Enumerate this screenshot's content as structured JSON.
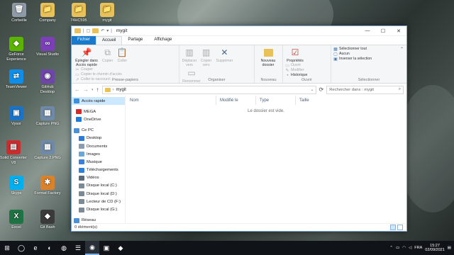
{
  "desktop": {
    "icons": [
      {
        "label": "Corbeille",
        "color": "#8e9aa8",
        "glyph": "🗑"
      },
      {
        "label": "Company",
        "color": "#e8c158",
        "glyph": "📁"
      },
      {
        "label": "74HC595",
        "color": "#e8c158",
        "glyph": "📁"
      },
      {
        "label": "mygit",
        "color": "#e8c158",
        "glyph": "📁"
      },
      {
        "label": "GeForce Experience",
        "color": "#5bb500",
        "glyph": "◆"
      },
      {
        "label": "Visual Studio",
        "color": "#7b3fb8",
        "glyph": "∞"
      },
      {
        "label": "TeamViewer",
        "color": "#0e8ee9",
        "glyph": "⇄"
      },
      {
        "label": "GitHub Desktop",
        "color": "#6e45a8",
        "glyph": "◉"
      },
      {
        "label": "Vysor",
        "color": "#1a73c9",
        "glyph": "▣"
      },
      {
        "label": "Capture PNG",
        "color": "#6f8aa7",
        "glyph": "▦"
      },
      {
        "label": "Solid Converter V8",
        "color": "#c92d2d",
        "glyph": "▤"
      },
      {
        "label": "Capture 2.PNG",
        "color": "#6f8aa7",
        "glyph": "▦"
      },
      {
        "label": "Skype",
        "color": "#00aff0",
        "glyph": "S"
      },
      {
        "label": "Format Factory",
        "color": "#d9822b",
        "glyph": "✱"
      },
      {
        "label": "Excel",
        "color": "#1f7244",
        "glyph": "X"
      },
      {
        "label": "Git Bash",
        "color": "#3a3a3a",
        "glyph": "◆"
      }
    ]
  },
  "window": {
    "title": "mygit",
    "controls": {
      "minimize": "—",
      "maximize": "☐",
      "close": "✕"
    },
    "tabs": [
      "Fichier",
      "Accueil",
      "Partage",
      "Affichage"
    ],
    "ribbon": {
      "presse_papiers": {
        "label": "Presse-papiers",
        "pin": "Épingler dans Accès rapide",
        "copy": "Copier",
        "paste": "Coller",
        "cut": "Couper",
        "copy_path": "Copier le chemin d'accès",
        "paste_shortcut": "Coller le raccourci"
      },
      "organiser": {
        "label": "Organiser",
        "move": "Déplacer vers",
        "copy_to": "Copier vers",
        "delete": "Supprimer",
        "rename": "Renommer"
      },
      "nouveau": {
        "label": "Nouveau",
        "new_folder": "Nouveau dossier"
      },
      "ouvrir": {
        "label": "Ouvrir",
        "properties": "Propriétés",
        "open": "Ouvrir",
        "modify": "Modifier",
        "history": "Historique"
      },
      "selectionner": {
        "label": "Sélectionner",
        "select_all": "Sélectionner tout",
        "select_none": "Aucun",
        "invert": "Inverser la sélection"
      }
    },
    "address": {
      "path": "mygit",
      "search_placeholder": "Rechercher dans : mygit"
    },
    "nav": [
      {
        "label": "Accès rapide",
        "color": "#3d8fe0",
        "selected": true
      },
      {
        "label": "MEGA",
        "color": "#d9272e"
      },
      {
        "label": "OneDrive",
        "color": "#1b7de0"
      },
      {
        "label": "Ce PC",
        "color": "#4a90d9"
      },
      {
        "label": "Desktop",
        "color": "#2e7bd6"
      },
      {
        "label": "Documents",
        "color": "#8a9bb0"
      },
      {
        "label": "Images",
        "color": "#6aa6d6"
      },
      {
        "label": "Musique",
        "color": "#3d7fd6"
      },
      {
        "label": "Téléchargements",
        "color": "#2f80d8"
      },
      {
        "label": "Vidéos",
        "color": "#5a6a7a"
      },
      {
        "label": "Disque local (C:)",
        "color": "#7c8a96"
      },
      {
        "label": "Disque local (D:)",
        "color": "#7c8a96"
      },
      {
        "label": "Lecteur de CD (F:)",
        "color": "#7c8a96"
      },
      {
        "label": "Disque local (G:)",
        "color": "#7c8a96"
      },
      {
        "label": "Réseau",
        "color": "#4a90d9"
      }
    ],
    "columns": [
      "Nom",
      "Modifié le",
      "Type",
      "Taille"
    ],
    "empty_message": "Le dossier est vide.",
    "status": "0 élément(s)"
  },
  "taskbar": {
    "apps": [
      "⊞",
      "◯",
      "e",
      "◐",
      "◍",
      "☰",
      "◉",
      "▣",
      "◆"
    ],
    "tray": {
      "language": "FRA",
      "time": "15:27",
      "date": "02/09/2021"
    }
  }
}
